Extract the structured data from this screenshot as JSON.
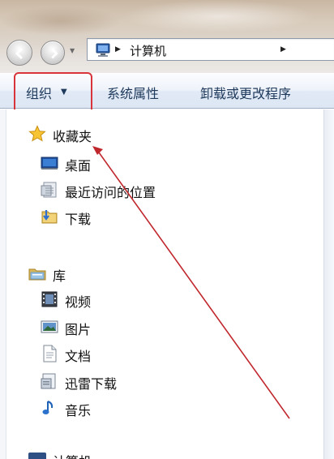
{
  "address_bar": {
    "path_text": "计算机"
  },
  "toolbar": {
    "organize_label": "组织",
    "system_properties_label": "系统属性",
    "uninstall_label": "卸载或更改程序"
  },
  "nav_pane": {
    "favorites": {
      "label": "收藏夹",
      "items": [
        {
          "label": "桌面",
          "icon": "desktop-icon"
        },
        {
          "label": "最近访问的位置",
          "icon": "recent-places-icon"
        },
        {
          "label": "下载",
          "icon": "downloads-folder-icon"
        }
      ]
    },
    "libraries": {
      "label": "库",
      "items": [
        {
          "label": "视频",
          "icon": "videos-icon"
        },
        {
          "label": "图片",
          "icon": "pictures-icon"
        },
        {
          "label": "文档",
          "icon": "documents-icon"
        },
        {
          "label": "迅雷下载",
          "icon": "thunder-download-icon"
        },
        {
          "label": "音乐",
          "icon": "music-icon"
        }
      ]
    },
    "computer_partial_label": "计算机"
  },
  "annotation": {
    "highlight_color": "#d9343c",
    "arrow_color": "#c0272d"
  }
}
